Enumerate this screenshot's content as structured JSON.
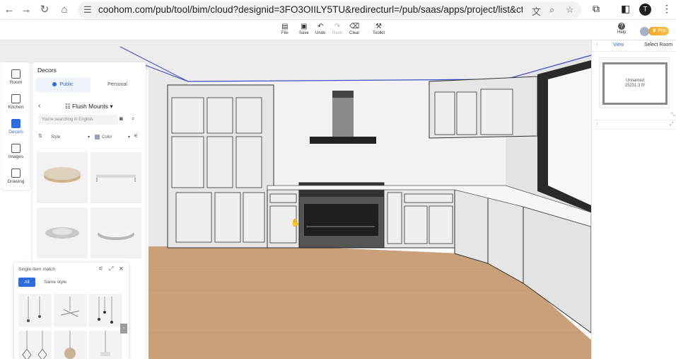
{
  "browser": {
    "url": "coohom.com/pub/tool/bim/cloud?designid=3FO3OIILY5TU&redirecturl=/pub/saas/apps/project/list&ctv=kb&locale=...",
    "profile_initial": "T"
  },
  "toolbar": {
    "file": "File",
    "save": "Save",
    "undo": "Undo",
    "redo": "Redo",
    "clear": "Clear",
    "toolkit": "Toolkit",
    "help": "Help",
    "pro": "Pro"
  },
  "rail": {
    "items": [
      {
        "label": "Room"
      },
      {
        "label": "Kitchen"
      },
      {
        "label": "Decors"
      },
      {
        "label": "Images"
      },
      {
        "label": "Drawing"
      }
    ]
  },
  "decors": {
    "title": "Decors",
    "tab_public": "Public",
    "tab_personal": "Personal",
    "category": "Flush Mounts",
    "search_placeholder": "You're searching in English",
    "filter_style": "Style",
    "filter_color": "Color"
  },
  "single_match": {
    "title": "Single-item match",
    "all": "All",
    "same_style": "Same style"
  },
  "right_panel": {
    "view": "View",
    "select_room": "Select Room",
    "room_name": "Unnamed",
    "room_area": "15231.3 ft²"
  },
  "colors": {
    "accent": "#2d6cdf",
    "floor": "#c9a07a",
    "wall": "#f2f2f2",
    "cabinet": "#e6e6e6"
  }
}
